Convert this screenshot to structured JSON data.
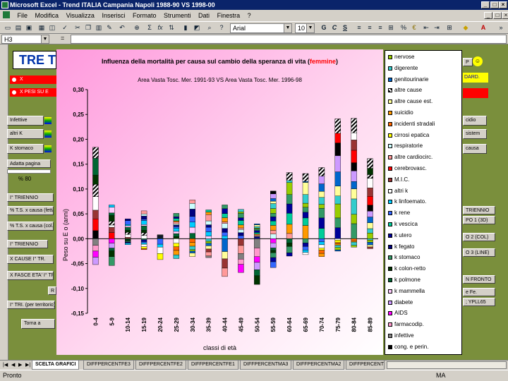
{
  "window": {
    "title": "Microsoft Excel - Trend ITALIA Campania Napoli 1988-90 VS 1998-00"
  },
  "menu": [
    "File",
    "Modifica",
    "Visualizza",
    "Inserisci",
    "Formato",
    "Strumenti",
    "Dati",
    "Finestra",
    "?"
  ],
  "toolbar": {
    "font": "Arial",
    "size": "10",
    "bold": "G",
    "italic": "C",
    "underline": "S",
    "sum": "Σ",
    "fx": "fx",
    "currency": "€",
    "percent": "%"
  },
  "formula": {
    "cell": "H3",
    "eq": "="
  },
  "sheet": {
    "title": "TRE T",
    "left_buttons": [
      "Infettive",
      "altri K",
      "K stomaco",
      "Adatta pagina",
      "% 80",
      "I° TRIENNIO",
      "% T.S. x causa (fetta)",
      "% T.S. x causa (col.)",
      "I° TRIENNIO",
      "X CAUSE I° TR.",
      "X FASCE ETA' I° TR.",
      "R",
      "I° TRI. (per territorio)",
      "Torna a"
    ],
    "right_buttons": [
      "P",
      "DARD.",
      "cidio",
      "sistem",
      "causa",
      "TRIENNIO",
      "PO 1 (3D)",
      "O 2 (COL)",
      "O 3 (LINE)",
      "N FRONTO",
      "e Fe.",
      "; YPLL65"
    ],
    "red_bars": [
      "X",
      "X PESI SU E"
    ]
  },
  "chart_data": {
    "type": "bar",
    "title": "Influenza della mortalità per causa sul cambio della speranza di vita (",
    "title_highlight": "femmine",
    "title_end": ")",
    "subtitle": "Area Vasta Tosc. Mer. 1991-93 VS Area Vasta Tosc. Mer. 1996-98",
    "xlabel": "classi di età",
    "ylabel": "Peso su E o (anni)",
    "ylim": [
      -0.15,
      0.3
    ],
    "yticks": [
      "0,30",
      "0,25",
      "0,20",
      "0,15",
      "0,10",
      "0,05",
      "0,00",
      "-0,05",
      "-0,10",
      "-0,15"
    ],
    "categories": [
      "0-4",
      "5-9",
      "10-14",
      "15-19",
      "20-24",
      "25-29",
      "30-34",
      "35-39",
      "40-44",
      "45-49",
      "50-54",
      "55-59",
      "60-64",
      "65-69",
      "70-74",
      "75-79",
      "80-84",
      "85-89"
    ],
    "pos_totals": [
      0.184,
      0.068,
      0.04,
      0.056,
      0.008,
      0.051,
      0.078,
      0.058,
      0.068,
      0.059,
      0.03,
      0.096,
      0.133,
      0.131,
      0.143,
      0.241,
      0.242,
      0.161
    ],
    "neg_totals": [
      -0.052,
      -0.054,
      -0.012,
      -0.022,
      -0.042,
      -0.04,
      -0.036,
      -0.038,
      -0.076,
      -0.068,
      -0.092,
      -0.058,
      -0.035,
      -0.032,
      -0.036,
      -0.025,
      -0.017,
      -0.02
    ],
    "legend": [
      "nervose",
      "digerente",
      "genitourinarie",
      "altre cause",
      "altre cause est.",
      "suicidio",
      "incidenti stradali",
      "cirrosi epatica",
      "respiratorie",
      "altre cardiocirc.",
      "cerebrovasc.",
      "M.I.C.",
      "altri k",
      "k linfoemato.",
      "k rene",
      "k vescica",
      "k utero",
      "k fegato",
      "k stomaco",
      "k colon-retto",
      "k polmone",
      "k mammella",
      "diabete",
      "AIDS",
      "farmacodip.",
      "infettive",
      "cong. e perin."
    ],
    "colors": [
      "#99cc00",
      "#33cccc",
      "#0066cc",
      "#000000",
      "#ffff99",
      "#ff9900",
      "#ff6600",
      "#ffff00",
      "#ccffff",
      "#ff9999",
      "#ff0000",
      "#993333",
      "#ffffff",
      "#00ccff",
      "#3366ff",
      "#00cc99",
      "#000099",
      "#000080",
      "#339966",
      "#003300",
      "#006633",
      "#ffccff",
      "#cc99ff",
      "#ff00ff",
      "#ff99cc",
      "#808080",
      "#000000"
    ]
  },
  "tabs": [
    "SCELTA GRAFICI",
    "DIFFPERCENTFE3",
    "DIFFPERCENTFE2",
    "DIFFPERCENTFE1",
    "DIFFPERCENTMA3",
    "DIFFPERCENTMA2",
    "DIFFPERCENT"
  ],
  "status": {
    "left": "Pronto",
    "right": "MA"
  }
}
